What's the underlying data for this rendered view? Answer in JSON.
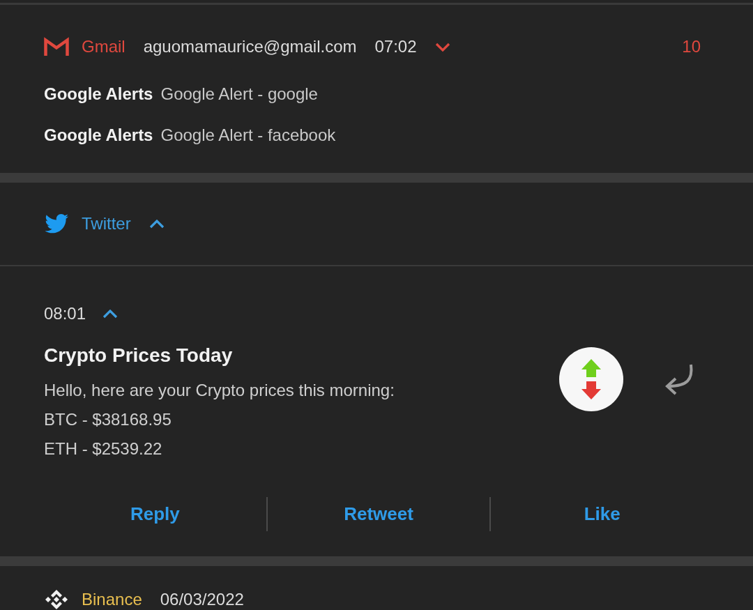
{
  "notifications": [
    {
      "kind": "gmail",
      "app": "Gmail",
      "color": "#e0483e",
      "account": "aguomamaurice@gmail.com",
      "time": "07:02",
      "expanded": false,
      "count": "10",
      "messages": [
        {
          "sender": "Google Alerts",
          "subject": "Google Alert - google"
        },
        {
          "sender": "Google Alerts",
          "subject": "Google Alert - facebook"
        }
      ]
    },
    {
      "kind": "twitter",
      "app": "Twitter",
      "color": "#3d9ee0",
      "expanded": true,
      "items": [
        {
          "time": "08:01",
          "expanded": true,
          "title": "Crypto Prices Today",
          "lines": [
            "Hello, here are your Crypto prices this morning:",
            "BTC - $38168.95",
            "ETH - $2539.22"
          ],
          "actions": [
            "Reply",
            "Retweet",
            "Like"
          ]
        }
      ]
    },
    {
      "kind": "binance",
      "app": "Binance",
      "color": "#e9bf4f",
      "time": "06/03/2022"
    }
  ]
}
